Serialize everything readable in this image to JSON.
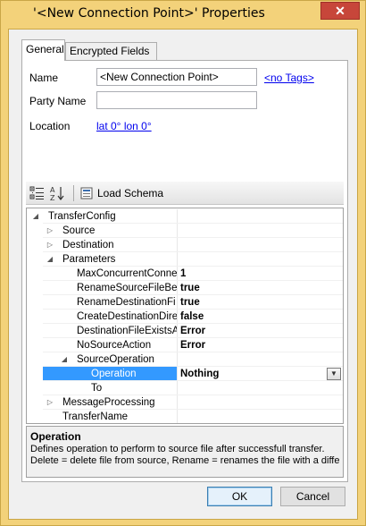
{
  "window": {
    "title": "'<New Connection Point>' Properties",
    "close_glyph": "✕"
  },
  "tabs": [
    {
      "label": "General",
      "active": true
    },
    {
      "label": "Encrypted Fields",
      "active": false
    }
  ],
  "form": {
    "name_label": "Name",
    "name_value": "<New Connection Point>",
    "tags_link": "<no Tags>",
    "party_label": "Party Name",
    "party_value": "",
    "location_label": "Location",
    "location_link": "lat 0°  lon 0°"
  },
  "toolbar": {
    "categorized_icon": "categorized-icon",
    "alphabetical_icon": "alphabetical-sort-icon",
    "load_schema_label": "Load Schema",
    "load_schema_icon": "schema-icon"
  },
  "grid": {
    "rows": [
      {
        "name": "TransferConfig",
        "value": "",
        "expander": "◢",
        "level": 0
      },
      {
        "name": "Source",
        "value": "",
        "expander": "▷",
        "level": 1
      },
      {
        "name": "Destination",
        "value": "",
        "expander": "▷",
        "level": 1
      },
      {
        "name": "Parameters",
        "value": "",
        "expander": "◢",
        "level": 1
      },
      {
        "name": "MaxConcurrentConne",
        "value": "1",
        "expander": "",
        "level": 2
      },
      {
        "name": "RenameSourceFileBe",
        "value": "true",
        "expander": "",
        "level": 2
      },
      {
        "name": "RenameDestinationFi",
        "value": "true",
        "expander": "",
        "level": 2
      },
      {
        "name": "CreateDestinationDire",
        "value": "false",
        "expander": "",
        "level": 2
      },
      {
        "name": "DestinationFileExistsA",
        "value": "Error",
        "expander": "",
        "level": 2
      },
      {
        "name": "NoSourceAction",
        "value": "Error",
        "expander": "",
        "level": 2
      },
      {
        "name": "SourceOperation",
        "value": "",
        "expander": "◢",
        "level": 2
      },
      {
        "name": "Operation",
        "value": "Nothing",
        "expander": "",
        "level": 3,
        "selected": true
      },
      {
        "name": "To",
        "value": "",
        "expander": "",
        "level": 3
      },
      {
        "name": "MessageProcessing",
        "value": "",
        "expander": "▷",
        "level": 1
      },
      {
        "name": "TransferName",
        "value": "",
        "expander": "",
        "level": 1
      }
    ]
  },
  "help": {
    "title": "Operation",
    "line1": "Defines operation to perform to source file after successfull transfer.",
    "line2": "Delete = delete file from source, Rename = renames the file with a differ..."
  },
  "buttons": {
    "ok": "OK",
    "cancel": "Cancel"
  },
  "colors": {
    "title_bar": "#f3d27a",
    "close_button": "#c7463a",
    "selection": "#3399ff",
    "link": "#0000ee"
  }
}
